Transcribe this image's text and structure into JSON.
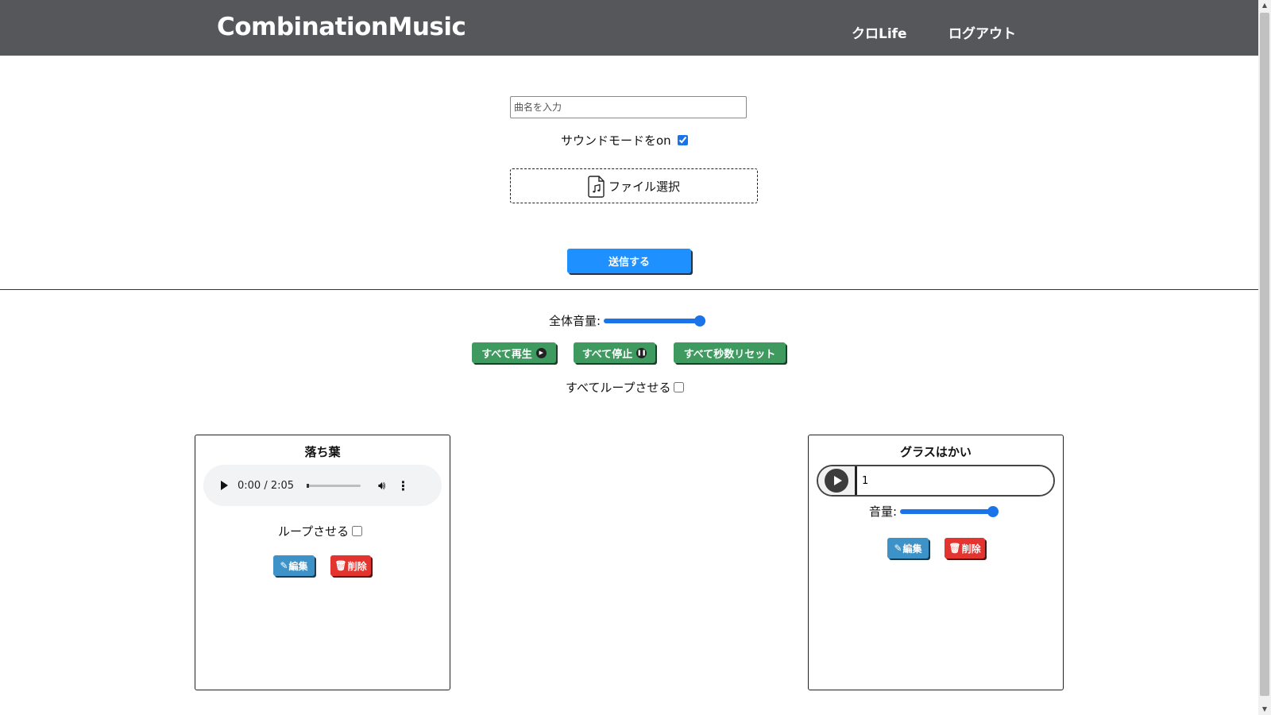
{
  "header": {
    "brand": "CombinationMusic",
    "nav": {
      "kuro_life": "クロLife",
      "logout": "ログアウト"
    }
  },
  "upload": {
    "song_name_placeholder": "曲名を入力",
    "sound_mode_label": "サウンドモードをon",
    "sound_mode_checked": true,
    "file_select_label": "ファイル選択",
    "submit_label": "送信する"
  },
  "global_controls": {
    "master_volume_label": "全体音量:",
    "master_volume": 1.0,
    "play_all_label": "すべて再生",
    "stop_all_label": "すべて停止",
    "reset_all_label": "すべて秒数リセット",
    "loop_all_label": "すべてループさせる",
    "loop_all_checked": false
  },
  "tracks": [
    {
      "title": "落ち葉",
      "player_time": "0:00 / 2:05",
      "loop_label": "ループさせる",
      "loop_checked": false,
      "edit_label": "編集",
      "delete_label": "削除"
    },
    {
      "title": "グラスはかい",
      "number_value": "1",
      "volume_label": "音量:",
      "volume": 1.0,
      "edit_label": "編集",
      "delete_label": "削除"
    }
  ],
  "colors": {
    "header_bg": "#55575b",
    "submit_blue": "#1e90ff",
    "green_button": "#3e9a5f",
    "edit_blue": "#3d93c7",
    "delete_red": "#e3342f",
    "slider_blue": "#1a73e8"
  }
}
